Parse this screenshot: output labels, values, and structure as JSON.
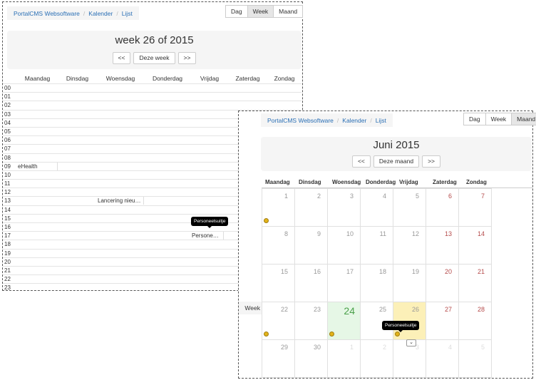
{
  "week_view": {
    "breadcrumb": [
      "PortalCMS Websoftware",
      "Kalender",
      "Lijst"
    ],
    "view_buttons": [
      "Dag",
      "Week",
      "Maand"
    ],
    "active_view": "Week",
    "title": "week 26 of 2015",
    "nav": {
      "prev": "<<",
      "current": "Deze week",
      "next": ">>"
    },
    "days": [
      "Maandag",
      "Dinsdag",
      "Woensdag",
      "Donderdag",
      "Vrijdag",
      "Zaterdag",
      "Zondag"
    ],
    "hours": [
      "00",
      "01",
      "02",
      "03",
      "04",
      "05",
      "06",
      "07",
      "08",
      "09",
      "10",
      "11",
      "12",
      "13",
      "14",
      "15",
      "16",
      "17",
      "18",
      "19",
      "20",
      "21",
      "22",
      "23"
    ],
    "events": [
      {
        "label": "eHealth",
        "day": "Maandag",
        "hour": "09"
      },
      {
        "label": "Lancering nieu…",
        "day": "Woensdag",
        "hour": "13"
      },
      {
        "label": "Persone…",
        "day": "Vrijdag",
        "hour": "17"
      }
    ],
    "tooltip": "Personeelsuitje"
  },
  "month_view": {
    "breadcrumb": [
      "PortalCMS Websoftware",
      "Kalender",
      "Lijst"
    ],
    "view_buttons": [
      "Dag",
      "Week",
      "Maand"
    ],
    "active_view": "Maand",
    "title": "Juni 2015",
    "nav": {
      "prev": "<<",
      "current": "Deze maand",
      "next": ">>"
    },
    "days": [
      "Maandag",
      "Dinsdag",
      "Woensdag",
      "Donderdag",
      "Vrijdag",
      "Zaterdag",
      "Zondag"
    ],
    "side_label": "Week",
    "weeks": [
      [
        "1",
        "2",
        "3",
        "4",
        "5",
        "6",
        "7"
      ],
      [
        "8",
        "9",
        "10",
        "11",
        "12",
        "13",
        "14"
      ],
      [
        "15",
        "16",
        "17",
        "18",
        "19",
        "20",
        "21"
      ],
      [
        "22",
        "23",
        "24",
        "25",
        "26",
        "27",
        "28"
      ],
      [
        "29",
        "30",
        "1",
        "2",
        "3",
        "4",
        "5"
      ]
    ],
    "today": "24",
    "tooltip": "Personeelsuitje",
    "expand_icon": "chevron-down-icon",
    "colors": {
      "event_dot": "#e2b31a",
      "today_bg": "#e6f7e6",
      "highlight_bg": "#fcf0b8",
      "weekend_text": "#b54b4b",
      "link": "#2a6fb5"
    }
  }
}
